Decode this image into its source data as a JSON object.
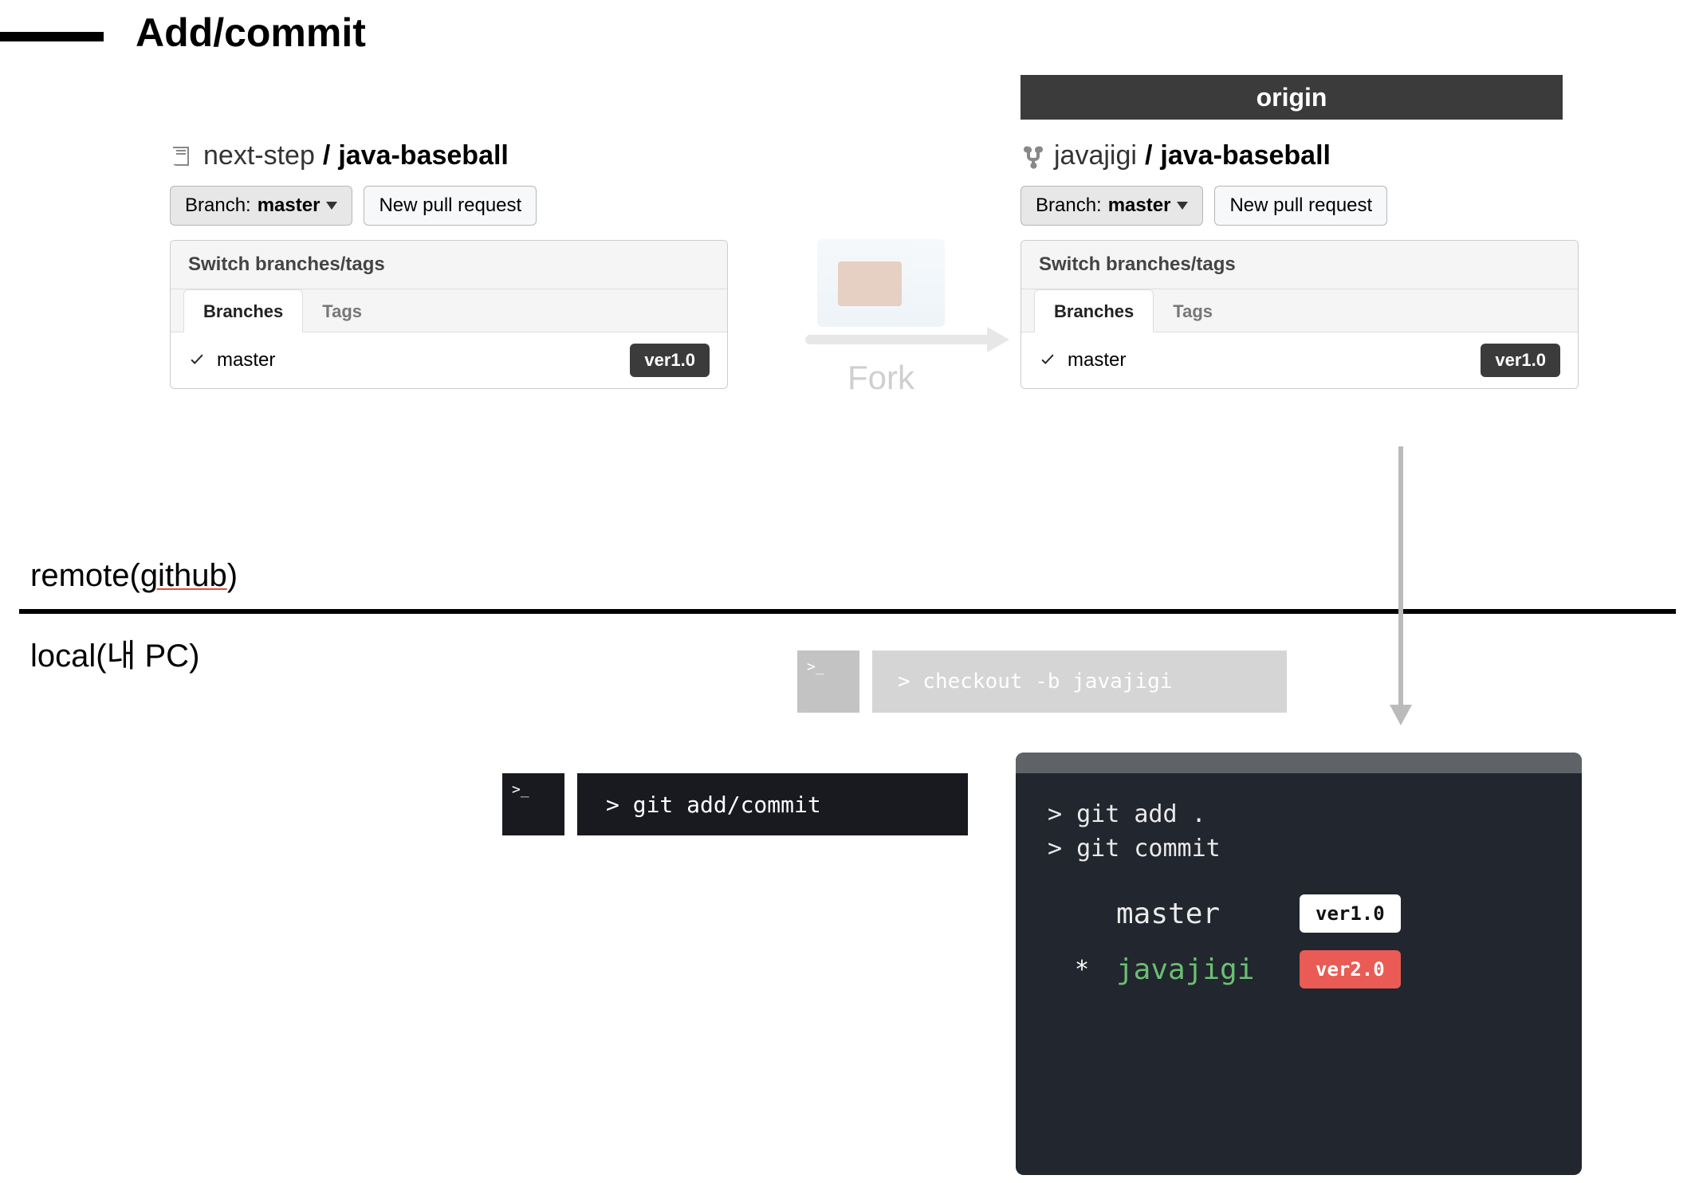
{
  "title": "Add/commit",
  "origin_label": "origin",
  "repo_left": {
    "owner": "next-step",
    "name": "java-baseball",
    "branch_btn_prefix": "Branch:",
    "branch_btn_branch": "master",
    "new_pr": "New pull request",
    "panel_header": "Switch branches/tags",
    "tab_branches": "Branches",
    "tab_tags": "Tags",
    "current_branch": "master",
    "ver_badge": "ver1.0"
  },
  "repo_right": {
    "owner": "javajigi",
    "name": "java-baseball",
    "branch_btn_prefix": "Branch:",
    "branch_btn_branch": "master",
    "new_pr": "New pull request",
    "panel_header": "Switch branches/tags",
    "tab_branches": "Branches",
    "tab_tags": "Tags",
    "current_branch": "master",
    "ver_badge": "ver1.0"
  },
  "fork_text": "Fork",
  "remote_label_plain": "remote(",
  "remote_label_underline": "github",
  "remote_label_tail": ")",
  "local_label": "local(내 PC)",
  "faded_term_prompt": ">_",
  "faded_term_cmd": "> checkout -b javajigi",
  "dark_term_prompt": ">_",
  "dark_term_cmd": "> git add/commit",
  "local_panel": {
    "cmd1": "> git add .",
    "cmd2": "> git commit",
    "rows": [
      {
        "star": "",
        "name": "master",
        "name_class": "b-master",
        "ver": "ver1.0",
        "ver_class": "v-white"
      },
      {
        "star": "*",
        "name": "javajigi",
        "name_class": "b-jj",
        "ver": "ver2.0",
        "ver_class": "v-red"
      }
    ]
  }
}
